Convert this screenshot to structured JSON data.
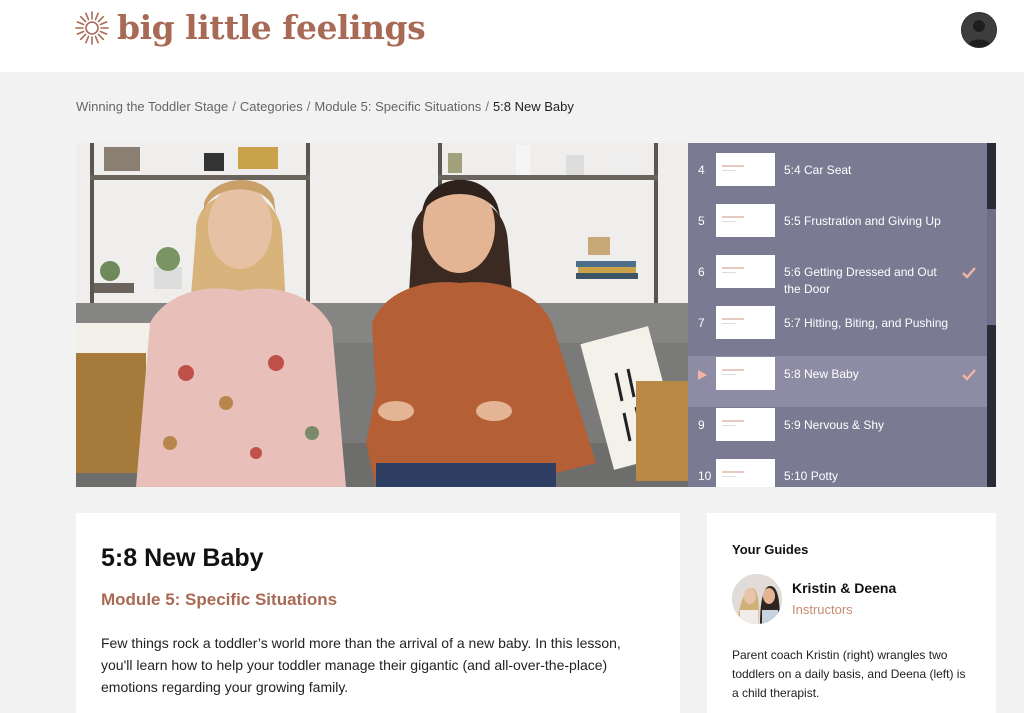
{
  "brand": {
    "name": "big little feelings",
    "color": "#a86a55"
  },
  "header": {
    "avatar_icon": "user-avatar-icon"
  },
  "breadcrumb": {
    "items": [
      "Winning the Toddler Stage",
      "Categories",
      "Module 5: Specific Situations"
    ],
    "current": "5:8 New Baby",
    "separator": "/"
  },
  "playlist": {
    "items": [
      {
        "number": "4",
        "title": "5:4 Car Seat",
        "completed": false,
        "active": false
      },
      {
        "number": "5",
        "title": "5:5 Frustration and Giving Up",
        "completed": false,
        "active": false
      },
      {
        "number": "6",
        "title": "5:6 Getting Dressed and Out the Door",
        "completed": true,
        "active": false
      },
      {
        "number": "7",
        "title": "5:7 Hitting, Biting, and Pushing",
        "completed": false,
        "active": false
      },
      {
        "number": "",
        "title": "5:8 New Baby",
        "completed": true,
        "active": true
      },
      {
        "number": "9",
        "title": "5:9 Nervous & Shy",
        "completed": false,
        "active": false
      },
      {
        "number": "10",
        "title": "5:10 Potty",
        "completed": false,
        "active": false
      }
    ],
    "bg_color": "#7b7a93",
    "active_color": "#8d8ca4",
    "check_color": "#f2b4a4"
  },
  "lesson": {
    "title": "5:8 New Baby",
    "module": "Module 5: Specific Situations",
    "description": "Few things rock a toddler’s world more than the arrival of a new baby. In this lesson, you'll learn how to help your toddler manage their gigantic (and all-over-the-place) emotions regarding your growing family."
  },
  "guides": {
    "heading": "Your Guides",
    "name": "Kristin & Deena",
    "role": "Instructors",
    "bio": "Parent coach Kristin (right) wrangles two toddlers on a daily basis, and Deena (left) is a child therapist."
  }
}
